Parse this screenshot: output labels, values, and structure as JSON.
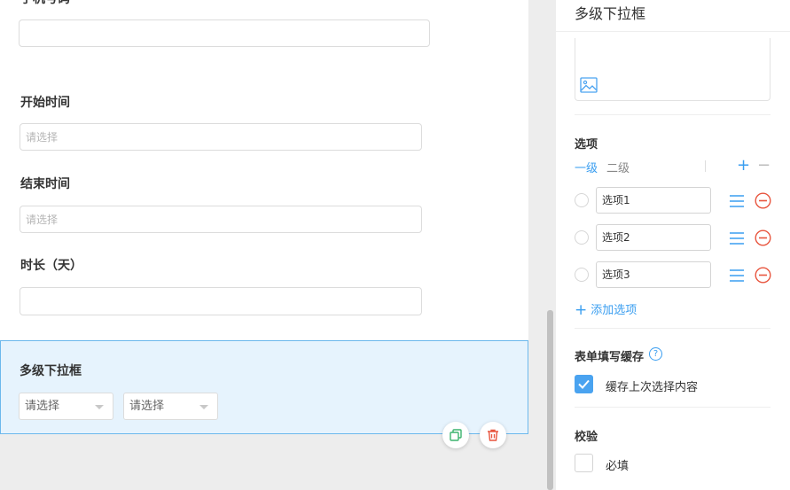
{
  "form": {
    "top_field_label": "手机号码",
    "fields": [
      {
        "label": "开始时间",
        "placeholder": "请选择"
      },
      {
        "label": "结束时间",
        "placeholder": "请选择"
      },
      {
        "label": "时长（天）",
        "placeholder": ""
      }
    ],
    "selected_field": {
      "label": "多级下拉框",
      "select_placeholders": [
        "请选择",
        "请选择"
      ]
    }
  },
  "panel": {
    "title": "多级下拉框",
    "options_section": {
      "title": "选项",
      "tabs": [
        "一级",
        "二级"
      ],
      "active_tab": 0,
      "items": [
        "选项1",
        "选项2",
        "选项3"
      ],
      "add_label": "添加选项"
    },
    "cache_section": {
      "title": "表单填写缓存",
      "checkbox_label": "缓存上次选择内容",
      "checked": true
    },
    "validation_section": {
      "title": "校验",
      "checkbox_label": "必填",
      "checked": false
    }
  },
  "colors": {
    "accent": "#3a9ef0",
    "danger": "#e8553e",
    "copy_icon": "#3cb46e",
    "selected_bg": "#e6f3fd",
    "selected_border": "#6cb8ec"
  },
  "icons": {
    "copy": "copy-icon",
    "delete": "trash-icon",
    "image": "image-icon",
    "menu": "menu-icon",
    "remove": "minus-circle-icon",
    "help": "question-circle-icon"
  }
}
